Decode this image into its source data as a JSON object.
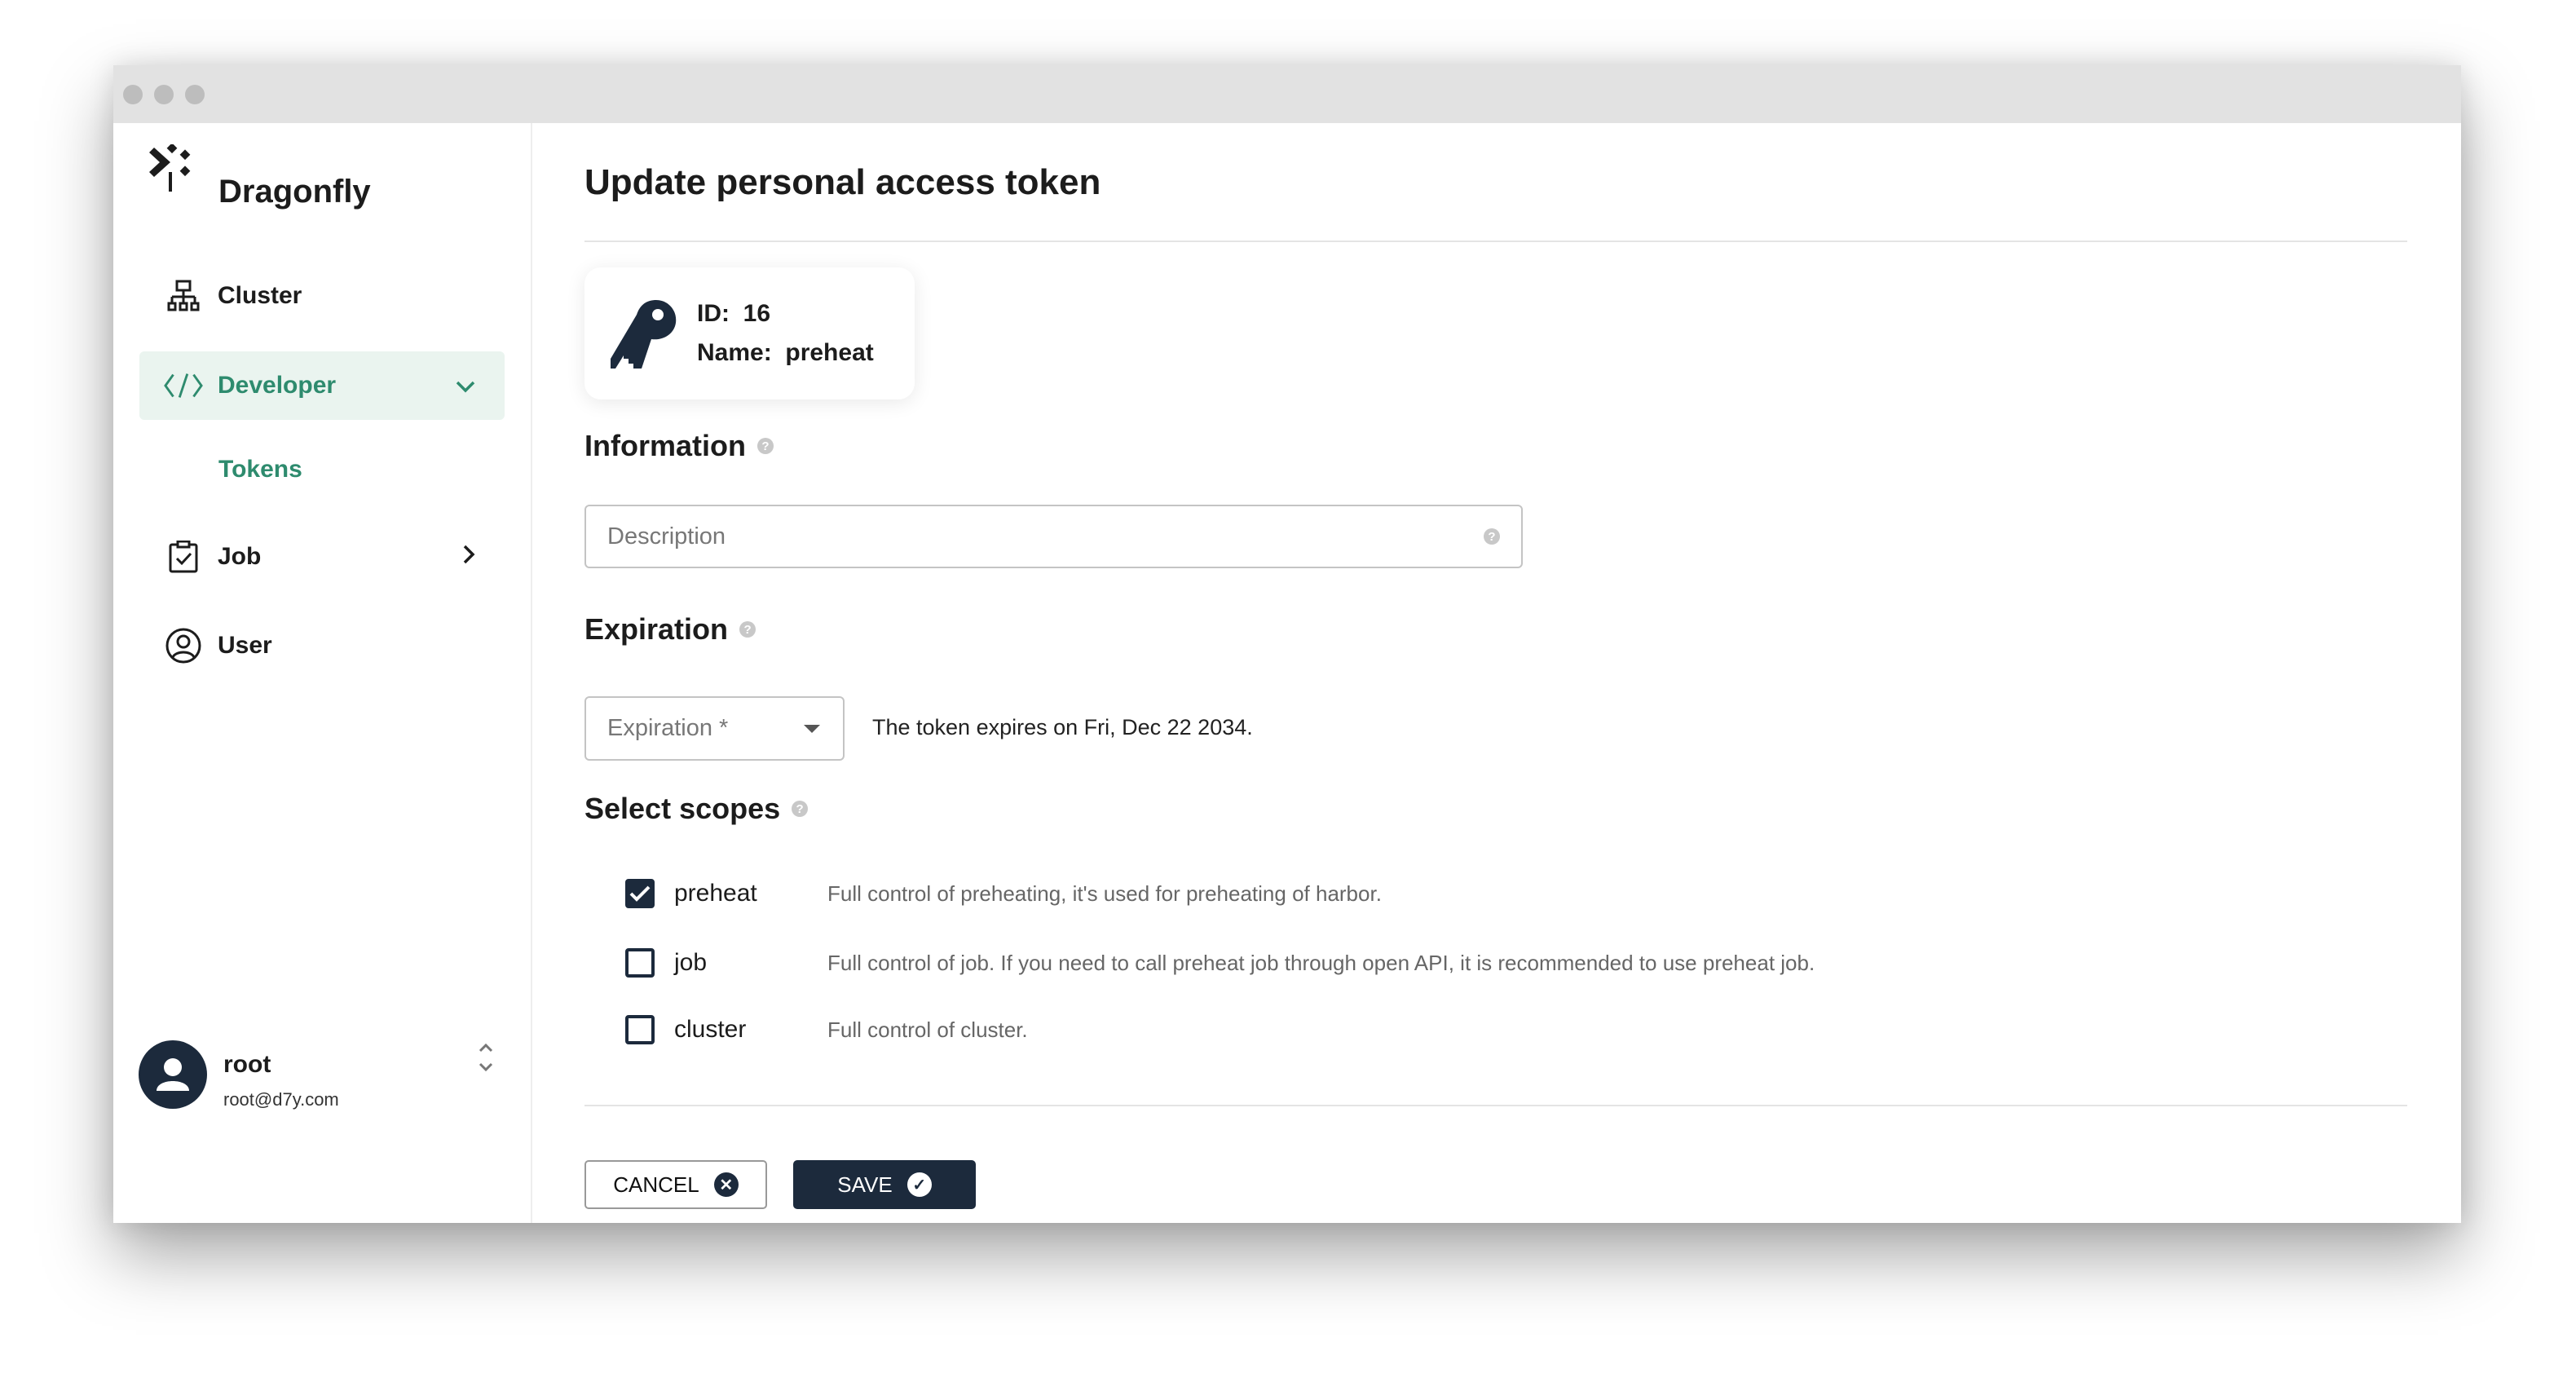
{
  "app": {
    "name": "Dragonfly"
  },
  "sidebar": {
    "items": [
      {
        "label": "Cluster",
        "icon": "sitemap-icon"
      },
      {
        "label": "Developer",
        "icon": "code-icon",
        "active": true,
        "expanded": true
      },
      {
        "label": "Tokens"
      },
      {
        "label": "Job",
        "icon": "clipboard-check-icon"
      },
      {
        "label": "User",
        "icon": "user-circle-icon"
      }
    ]
  },
  "user": {
    "name": "root",
    "email": "root@d7y.com"
  },
  "page": {
    "title": "Update personal access token"
  },
  "token": {
    "id_label": "ID:",
    "id": "16",
    "name_label": "Name:",
    "name": "preheat"
  },
  "information": {
    "heading": "Information",
    "description_placeholder": "Description"
  },
  "expiration": {
    "heading": "Expiration",
    "select_label": "Expiration *",
    "hint": "The token expires on Fri, Dec 22 2034."
  },
  "scopes": {
    "heading": "Select scopes",
    "items": [
      {
        "label": "preheat",
        "checked": true,
        "description": "Full control of preheating, it's used for preheating of harbor."
      },
      {
        "label": "job",
        "checked": false,
        "description": "Full control of job. If you need to call preheat job through open API, it is recommended to use preheat job."
      },
      {
        "label": "cluster",
        "checked": false,
        "description": "Full control of cluster."
      }
    ]
  },
  "actions": {
    "cancel": "CANCEL",
    "save": "SAVE"
  },
  "colors": {
    "accent": "#2e8b6e",
    "primary": "#1c2a3c",
    "active_bg": "#eaf4ef"
  }
}
